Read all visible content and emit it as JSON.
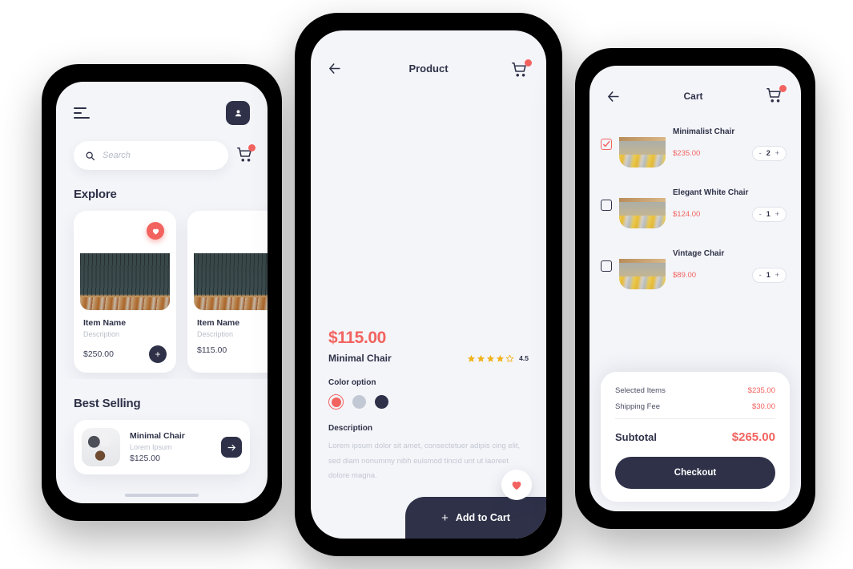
{
  "theme": {
    "accent": "#F2635F",
    "dark": "#2E3148",
    "screen_bg": "#F4F5F9",
    "card_bg": "#FFFFFF",
    "muted_text": "#BCC1CC"
  },
  "home_screen": {
    "menu_icon": "hamburger-icon",
    "profile_icon": "person-icon",
    "search": {
      "icon": "search-icon",
      "placeholder": "Search",
      "value": ""
    },
    "cart": {
      "icon": "cart-icon",
      "badge": ""
    },
    "explore": {
      "title": "Explore",
      "products": [
        {
          "name": "Item Name",
          "description": "Description",
          "price": "$250.00",
          "favorite": true,
          "favorite_icon": "heart-icon",
          "add_label": "+"
        },
        {
          "name": "Item Name",
          "description": "Description",
          "price": "$115.00",
          "favorite": false,
          "favorite_icon": "heart-icon",
          "add_label": "+"
        }
      ]
    },
    "best_selling": {
      "title": "Best Selling",
      "item": {
        "name": "Minimal Chair",
        "description": "Lorem Ipsum",
        "price": "$125.00",
        "go_icon": "arrow-right-icon"
      }
    }
  },
  "product_screen": {
    "back_icon": "arrow-left-icon",
    "title": "Product",
    "cart": {
      "icon": "cart-icon",
      "badge": ""
    },
    "favorite_icon": "heart-icon",
    "price": "$115.00",
    "name": "Minimal Chair",
    "rating": {
      "value": "4.5",
      "stars_filled": 4,
      "stars_total": 5,
      "star_icon": "star-icon"
    },
    "color_option": {
      "label": "Color option",
      "swatches": [
        {
          "color": "#F2635F",
          "selected": true
        },
        {
          "color": "#C3C9D4",
          "selected": false
        },
        {
          "color": "#2E3148",
          "selected": false
        }
      ]
    },
    "description": {
      "label": "Description",
      "body": "Lorem ipsum dolor sit amet, consectetuer adipis cing elit, sed diam nonummy nibh euismod tincid unt ut laoreet dolore magna."
    },
    "add_to_cart": {
      "icon": "plus-icon",
      "label": "Add to Cart"
    }
  },
  "cart_screen": {
    "back_icon": "arrow-left-icon",
    "title": "Cart",
    "cart": {
      "icon": "cart-icon",
      "badge": ""
    },
    "items": [
      {
        "name": "Minimalist Chair",
        "price": "$235.00",
        "quantity": "2",
        "selected": true,
        "decrement": "-",
        "increment": "+",
        "checkbox_icon": "checkbox-checked-icon"
      },
      {
        "name": "Elegant White Chair",
        "price": "$124.00",
        "quantity": "1",
        "selected": false,
        "decrement": "-",
        "increment": "+",
        "checkbox_icon": "checkbox-icon"
      },
      {
        "name": "Vintage Chair",
        "price": "$89.00",
        "quantity": "1",
        "selected": false,
        "decrement": "-",
        "increment": "+",
        "checkbox_icon": "checkbox-icon"
      }
    ],
    "summary": {
      "selected_items_label": "Selected Items",
      "selected_items_value": "$235.00",
      "shipping_label": "Shipping Fee",
      "shipping_value": "$30.00",
      "subtotal_label": "Subtotal",
      "subtotal_value": "$265.00",
      "checkout_label": "Checkout"
    }
  }
}
